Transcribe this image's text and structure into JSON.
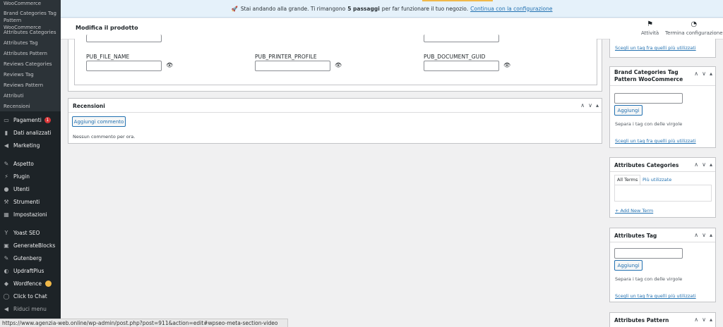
{
  "sidebar": {
    "sub_items": [
      {
        "label": "WooCommerce"
      },
      {
        "label": "Brand Categories Tag Pattern WooCommerce"
      },
      {
        "label": "Attributes Categories"
      },
      {
        "label": "Attributes Tag"
      },
      {
        "label": "Attributes Pattern"
      },
      {
        "label": "Reviews Categories"
      },
      {
        "label": "Reviews Tag"
      },
      {
        "label": "Reviews Pattern"
      },
      {
        "label": "Attributi"
      },
      {
        "label": "Recensioni"
      }
    ],
    "menu": [
      {
        "label": "Pagamenti",
        "icon": "credit-card-icon",
        "badge": "1"
      },
      {
        "label": "Dati analizzati",
        "icon": "bar-chart-icon"
      },
      {
        "label": "Marketing",
        "icon": "megaphone-icon"
      },
      {
        "label": "Aspetto",
        "icon": "paintbrush-icon"
      },
      {
        "label": "Plugin",
        "icon": "plug-icon"
      },
      {
        "label": "Utenti",
        "icon": "user-icon"
      },
      {
        "label": "Strumenti",
        "icon": "wrench-icon"
      },
      {
        "label": "Impostazioni",
        "icon": "settings-icon"
      },
      {
        "label": "Yoast SEO",
        "icon": "yoast-icon"
      },
      {
        "label": "GenerateBlocks",
        "icon": "blocks-icon"
      },
      {
        "label": "Gutenberg",
        "icon": "gutenberg-icon"
      },
      {
        "label": "UpdraftPlus",
        "icon": "updraft-icon"
      },
      {
        "label": "Wordfence",
        "icon": "shield-icon"
      },
      {
        "label": "Click to Chat",
        "icon": "chat-icon"
      },
      {
        "label": "Riduci menu",
        "icon": "collapse-icon"
      }
    ]
  },
  "status_url": "https://www.agenzia-web.online/wp-admin/post.php?post=911&action=edit#wpseo-meta-section-video",
  "notice": {
    "prefix": "Stai andando alla grande. Ti rimangono",
    "bold": "5 passaggi",
    "suffix": "per far funzionare il tuo negozio.",
    "link": "Continua con la configurazione",
    "icon": "rocket-icon"
  },
  "header": {
    "title": "Modifica il prodotto",
    "activity_label": "Attività",
    "finish_label": "Termina configurazione"
  },
  "fields": [
    {
      "label": "PUB_FILE_NAME",
      "value": ""
    },
    {
      "label": "PUB_PRINTER_PROFILE",
      "value": ""
    },
    {
      "label": "PUB_DOCUMENT_GUID",
      "value": ""
    }
  ],
  "reviews": {
    "title": "Recensioni",
    "add_button": "Aggiungi commento",
    "empty": "Nessun commento per ora."
  },
  "right": {
    "top_link": "Scegli un tag fra quelli più utilizzati",
    "brand_box": {
      "title": "Brand Categories Tag Pattern WooCommerce",
      "button": "Aggiungi",
      "hint": "Separa i tag con delle virgole",
      "link": "Scegli un tag fra quelli più utilizzati"
    },
    "attr_cat_box": {
      "title": "Attributes Categories",
      "tab_all": "All Terms",
      "tab_used": "Più utilizzate",
      "add_link": "+ Add New Term"
    },
    "attr_tag_box": {
      "title": "Attributes Tag",
      "button": "Aggiungi",
      "hint": "Separa i tag con delle virgole",
      "link": "Scegli un tag fra quelli più utilizzati"
    },
    "attr_pattern_box": {
      "title": "Attributes Pattern"
    }
  },
  "box_controls": {
    "up": "∧",
    "down": "∨",
    "toggle": "▴"
  },
  "colors": {
    "sidebar_bg": "#1d2327",
    "accent": "#2271b1",
    "badge": "#d63638",
    "notice_bg": "#e5f1fa"
  }
}
